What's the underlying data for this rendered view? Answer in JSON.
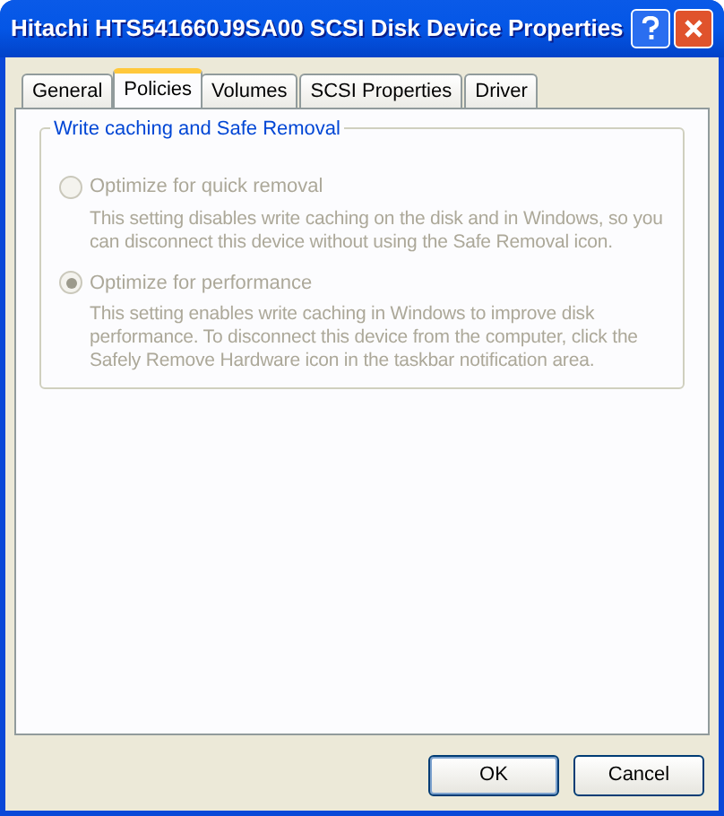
{
  "window": {
    "title": "Hitachi HTS541660J9SA00 SCSI Disk Device Properties"
  },
  "tabs": [
    {
      "label": "General",
      "selected": false
    },
    {
      "label": "Policies",
      "selected": true
    },
    {
      "label": "Volumes",
      "selected": false
    },
    {
      "label": "SCSI Properties",
      "selected": false
    },
    {
      "label": "Driver",
      "selected": false
    }
  ],
  "group": {
    "title": "Write caching and Safe Removal",
    "options": [
      {
        "label": "Optimize for quick removal",
        "selected": false,
        "disabled": true,
        "description": "This setting disables write caching on the disk and in Windows, so you can disconnect this device without using the Safe Removal icon."
      },
      {
        "label": "Optimize for performance",
        "selected": true,
        "disabled": true,
        "description": "This setting enables write caching in Windows to improve disk performance. To disconnect this device from the computer, click the Safely Remove Hardware icon in the taskbar notification area."
      }
    ]
  },
  "buttons": [
    {
      "label": "OK",
      "default": true
    },
    {
      "label": "Cancel",
      "default": false
    }
  ]
}
